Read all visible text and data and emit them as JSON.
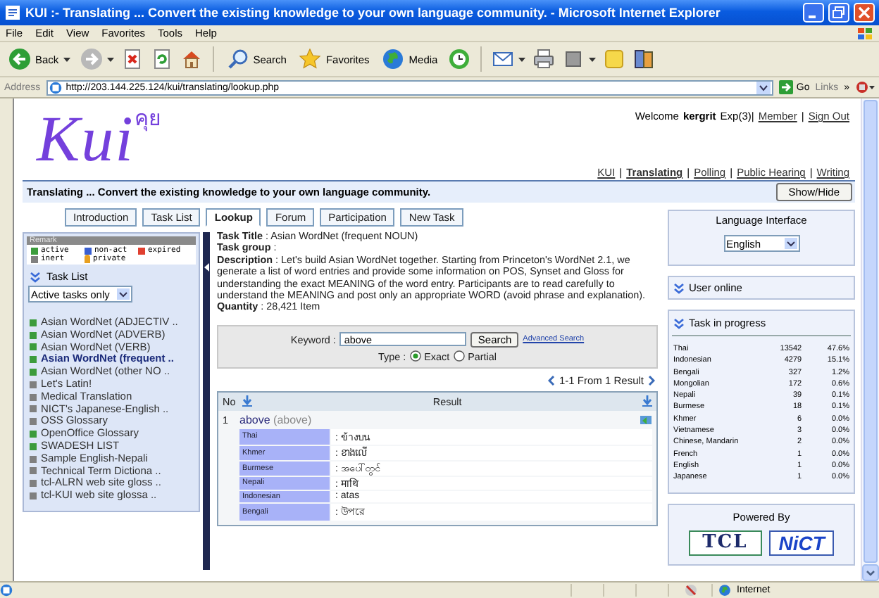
{
  "window": {
    "title": "KUI :- Translating ... Convert the existing knowledge to your own language community. - Microsoft Internet Explorer"
  },
  "menu": [
    "File",
    "Edit",
    "View",
    "Favorites",
    "Tools",
    "Help"
  ],
  "toolbar": [
    {
      "kind": "back",
      "label": "Back"
    },
    {
      "kind": "forward"
    },
    {
      "kind": "stop"
    },
    {
      "kind": "refresh"
    },
    {
      "kind": "home"
    },
    {
      "kind": "search",
      "label": "Search"
    },
    {
      "kind": "favorites",
      "label": "Favorites"
    },
    {
      "kind": "media",
      "label": "Media"
    },
    {
      "kind": "history"
    },
    {
      "kind": "mail"
    },
    {
      "kind": "print"
    },
    {
      "kind": "edit"
    },
    {
      "kind": "discuss"
    },
    {
      "kind": "research"
    }
  ],
  "address": {
    "label": "Address",
    "url": "http://203.144.225.124/kui/translating/lookup.php",
    "go": "Go",
    "links": "Links",
    "more": "»"
  },
  "header": {
    "logo": "Kui",
    "logo_thai": "คุย",
    "welcome": "Welcome",
    "user": "kergrit",
    "exp": "Exp(3)|",
    "separator": "|",
    "account_links": [
      "Member",
      "Sign Out"
    ],
    "nav": [
      {
        "label": "KUI",
        "selected": false
      },
      {
        "label": "Translating",
        "selected": true
      },
      {
        "label": "Polling",
        "selected": false
      },
      {
        "label": "Public Hearing",
        "selected": false
      },
      {
        "label": "Writing",
        "selected": false
      }
    ]
  },
  "banner": {
    "text": "Translating ... Convert the existing knowledge to your own language community.",
    "button": "Show/Hide"
  },
  "tabs": [
    {
      "label": "Introduction",
      "selected": false
    },
    {
      "label": "Task List",
      "selected": false
    },
    {
      "label": "Lookup",
      "selected": true
    },
    {
      "label": "Forum",
      "selected": false
    },
    {
      "label": "Participation",
      "selected": false
    },
    {
      "label": "New Task",
      "selected": false
    }
  ],
  "remark": {
    "title": "Remark",
    "legend": [
      {
        "label": "active",
        "color": "#3c9c3c"
      },
      {
        "label": "non-act",
        "color": "#3a5fd0"
      },
      {
        "label": "expired",
        "color": "#e04030"
      },
      {
        "label": "inert",
        "color": "#808080"
      },
      {
        "label": "private",
        "color": "#e8a020"
      }
    ]
  },
  "task_list": {
    "title": "Task List",
    "filter": "Active tasks only",
    "items": [
      {
        "label": "Asian WordNet (ADJECTIV ..",
        "color": "#3c9c3c",
        "selected": false
      },
      {
        "label": "Asian WordNet (ADVERB)",
        "color": "#3c9c3c",
        "selected": false
      },
      {
        "label": "Asian WordNet (VERB)",
        "color": "#3c9c3c",
        "selected": false
      },
      {
        "label": "Asian WordNet (frequent ..",
        "color": "#3c9c3c",
        "selected": true
      },
      {
        "label": "Asian WordNet (other NO ..",
        "color": "#3c9c3c",
        "selected": false
      },
      {
        "label": "Let's Latin!",
        "color": "#808080",
        "selected": false
      },
      {
        "label": "Medical Translation",
        "color": "#808080",
        "selected": false
      },
      {
        "label": "NICT's Japanese-English ..",
        "color": "#808080",
        "selected": false
      },
      {
        "label": "OSS Glossary",
        "color": "#808080",
        "selected": false
      },
      {
        "label": "OpenOffice Glossary",
        "color": "#3c9c3c",
        "selected": false
      },
      {
        "label": "SWADESH LIST",
        "color": "#3c9c3c",
        "selected": false
      },
      {
        "label": "Sample English-Nepali",
        "color": "#808080",
        "selected": false
      },
      {
        "label": "Technical Term Dictiona ..",
        "color": "#808080",
        "selected": false
      },
      {
        "label": "tcl-ALRN web site gloss ..",
        "color": "#808080",
        "selected": false
      },
      {
        "label": "tcl-KUI web site glossa ..",
        "color": "#808080",
        "selected": false
      }
    ]
  },
  "task": {
    "lines": [
      "**Task Title** : Asian WordNet (frequent NOUN)",
      "**Task group** :",
      "**Description** : Let's build Asian WordNet together. Starting from Princeton's WordNet 2.1, we generate a list of word entries and provide some information on POS, Synset and Gloss for understanding the exact MEANING of the word entry. Participants are to read carefully to understand the MEANING and post only an appropriate WORD (avoid phrase and explanation).",
      "**Quantity** : 28,421 Item"
    ]
  },
  "search": {
    "keyword_label": "Keyword :",
    "keyword": "above",
    "button": "Search",
    "advanced": "Advanced Search",
    "type_label": "Type :",
    "types": [
      {
        "label": "Exact",
        "selected": true
      },
      {
        "label": "Partial",
        "selected": false
      }
    ]
  },
  "pager": {
    "text": "1-1 From 1 Result"
  },
  "results": {
    "columns": [
      "No",
      "Result"
    ],
    "rows": [
      {
        "no": "1",
        "word": "above",
        "gloss": "(above)",
        "translations": [
          {
            "language": "Thai",
            "value": ": ข้างบน"
          },
          {
            "language": "Khmer",
            "value": ": ខាងលើ"
          },
          {
            "language": "Burmese",
            "value": ": အပေါ်တွင်"
          },
          {
            "language": "Nepali",
            "value": ": माथि"
          },
          {
            "language": "Indonesian",
            "value": ": atas"
          },
          {
            "language": "Bengali",
            "value": ": উপরে"
          }
        ]
      }
    ]
  },
  "language_interface": {
    "title": "Language Interface",
    "value": "English"
  },
  "user_online": {
    "title": "User online"
  },
  "task_in_progress": {
    "title": "Task in progress",
    "rows": [
      {
        "language": "Thai",
        "count": "13542",
        "percent": "47.6%"
      },
      {
        "language": "Indonesian",
        "count": "4279",
        "percent": "15.1%"
      },
      {
        "language": "Bengali",
        "count": "327",
        "percent": "1.2%"
      },
      {
        "language": "Mongolian",
        "count": "172",
        "percent": "0.6%"
      },
      {
        "language": "Nepali",
        "count": "39",
        "percent": "0.1%"
      },
      {
        "language": "Burmese",
        "count": "18",
        "percent": "0.1%"
      },
      {
        "language": "Khmer",
        "count": "6",
        "percent": "0.0%"
      },
      {
        "language": "Vietnamese",
        "count": "3",
        "percent": "0.0%"
      },
      {
        "language": "Chinese, Mandarin",
        "count": "2",
        "percent": "0.0%"
      },
      {
        "language": "French",
        "count": "1",
        "percent": "0.0%"
      },
      {
        "language": "English",
        "count": "1",
        "percent": "0.0%"
      },
      {
        "language": "Japanese",
        "count": "1",
        "percent": "0.0%"
      }
    ]
  },
  "powered_by": {
    "title": "Powered By",
    "logos": [
      "TCL",
      "NiCT"
    ]
  },
  "status_bar": {
    "zone": "Internet"
  }
}
